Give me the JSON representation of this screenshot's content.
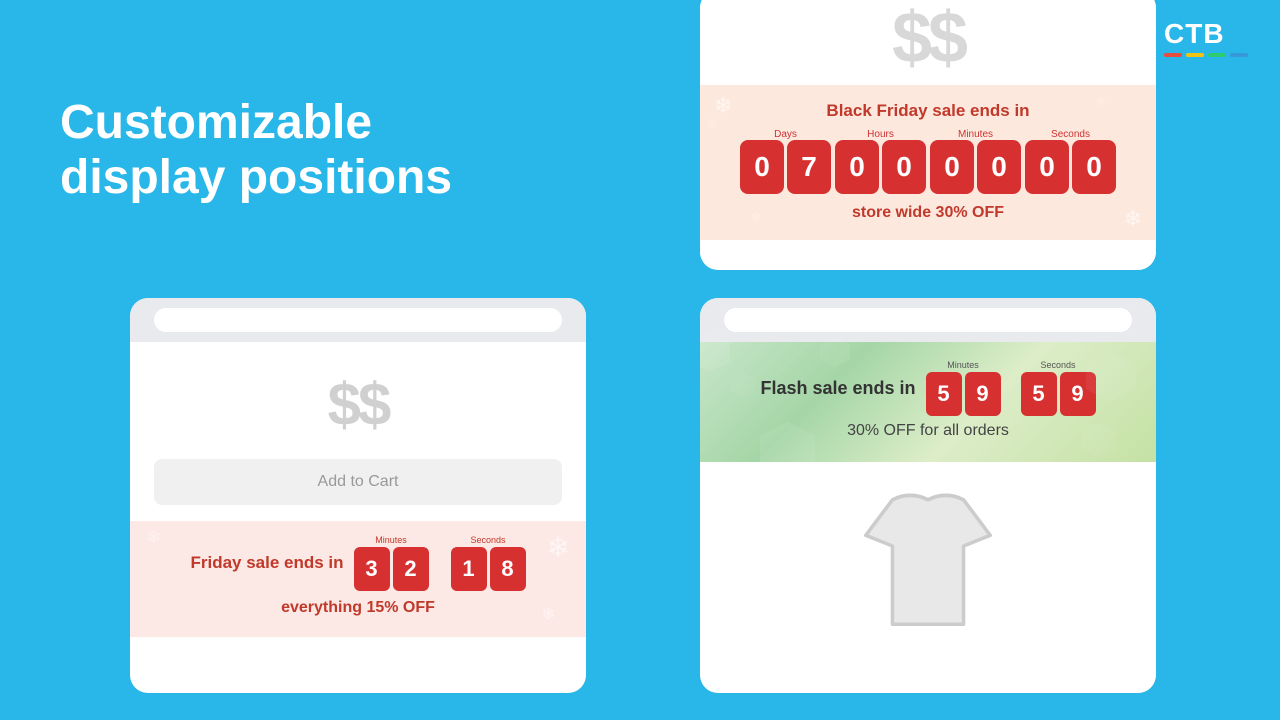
{
  "logo": {
    "text": "CTB",
    "bars": [
      "red",
      "yellow",
      "green",
      "blue"
    ]
  },
  "headline": {
    "line1": "Customizable",
    "line2": "display positions"
  },
  "card_top_right": {
    "dollar_sign": "$$",
    "banner": {
      "title": "Black Friday sale ends in",
      "timer": {
        "days_label": "Days",
        "hours_label": "Hours",
        "minutes_label": "Minutes",
        "seconds_label": "Seconds",
        "days": [
          "0",
          "7"
        ],
        "hours": [
          "0",
          "0"
        ],
        "minutes": [
          "0",
          "0"
        ],
        "seconds": [
          "0",
          "0"
        ]
      },
      "subtitle": "store wide 30% OFF"
    }
  },
  "card_bottom_left": {
    "dollar_sign": "$$",
    "add_to_cart": "Add to Cart",
    "banner": {
      "title": "Friday sale ends in",
      "timer": {
        "minutes_label": "Minutes",
        "seconds_label": "Seconds",
        "minutes": [
          "3",
          "2"
        ],
        "seconds": [
          "1",
          "8"
        ]
      },
      "subtitle": "everything 15% OFF"
    }
  },
  "card_bottom_right": {
    "banner": {
      "sale_text": "Flash sale ends in",
      "timer": {
        "minutes_label": "Minutes",
        "seconds_label": "Seconds",
        "minutes": [
          "5",
          "9"
        ],
        "seconds": [
          "5",
          "9"
        ]
      },
      "subtitle": "30% OFF for all orders"
    }
  }
}
